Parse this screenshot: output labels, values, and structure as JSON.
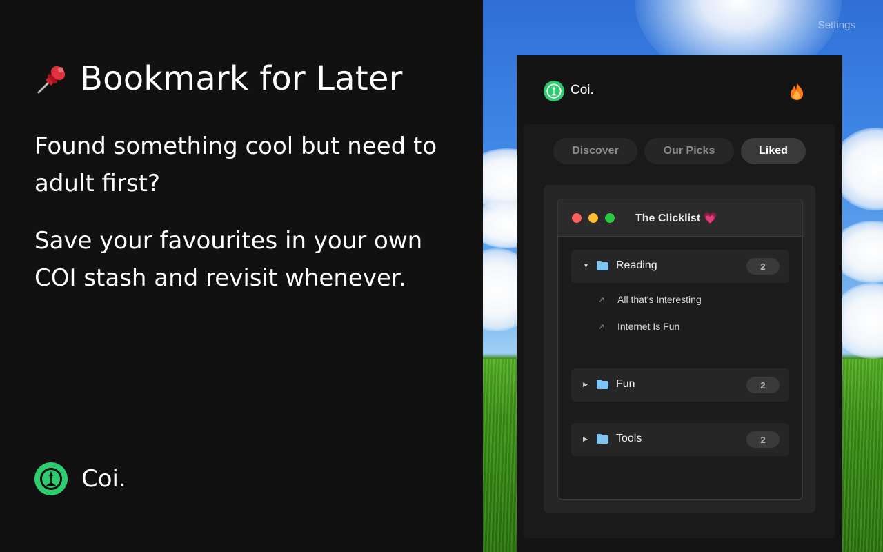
{
  "promo": {
    "title": "Bookmark for Later",
    "paragraph1": "Found something cool but need to adult first?",
    "paragraph2": "Save your favourites in your own COI stash and revisit whenever.",
    "brand_name": "Coi."
  },
  "nav": {
    "settings_label": "Settings"
  },
  "app": {
    "name": "Coi.",
    "tabs": [
      {
        "label": "Discover",
        "active": false
      },
      {
        "label": "Our Picks",
        "active": false
      },
      {
        "label": "Liked",
        "active": true
      }
    ],
    "window_title": "The Clicklist 💗",
    "folders": [
      {
        "name": "Reading",
        "count": "2",
        "expanded": true,
        "items": [
          "All that's Interesting",
          "Internet Is Fun"
        ]
      },
      {
        "name": "Fun",
        "count": "2",
        "expanded": false,
        "items": []
      },
      {
        "name": "Tools",
        "count": "2",
        "expanded": false,
        "items": []
      }
    ]
  },
  "icons": {
    "pin": "pushpin-icon",
    "logo": "coi-logo-icon",
    "fire": "fire-icon",
    "folder": "folder-icon",
    "link": "external-link-arrow-icon"
  },
  "colors": {
    "brand_green": "#2ecc71",
    "folder_blue": "#7cc4f2",
    "dot_red": "#ff5f57",
    "dot_yellow": "#febc2e",
    "dot_green": "#28c840",
    "fire_orange": "#ff7a1a"
  }
}
